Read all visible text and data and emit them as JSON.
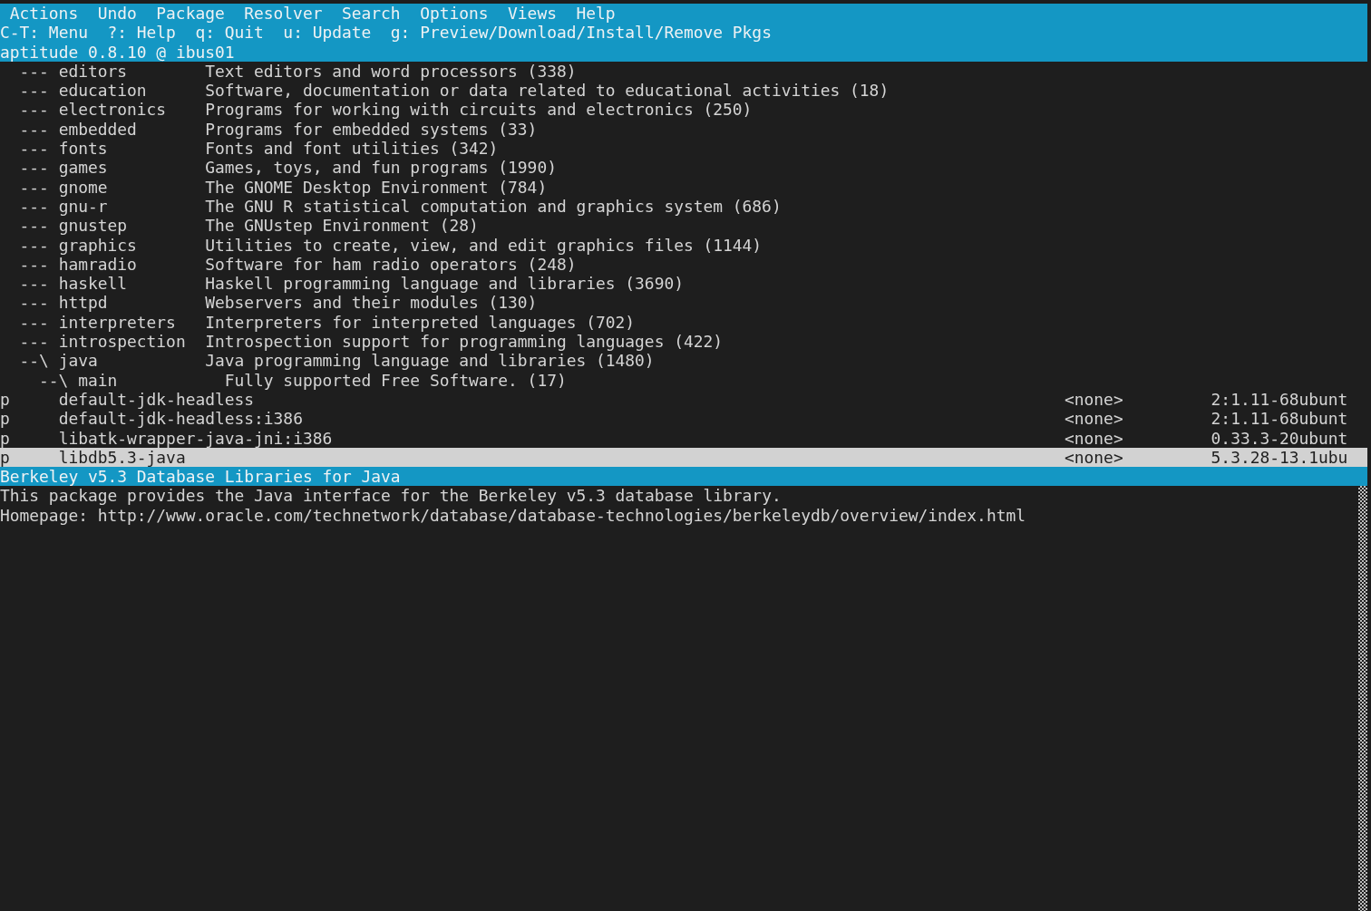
{
  "menu": [
    {
      "label": "Actions"
    },
    {
      "label": "Undo"
    },
    {
      "label": "Package"
    },
    {
      "label": "Resolver"
    },
    {
      "label": "Search"
    },
    {
      "label": "Options"
    },
    {
      "label": "Views"
    },
    {
      "label": "Help"
    }
  ],
  "shortcuts": "C-T: Menu  ?: Help  q: Quit  u: Update  g: Preview/Download/Install/Remove Pkgs",
  "title": "aptitude 0.8.10 @ ibus01",
  "tree": [
    {
      "marker": "---",
      "name": "editors",
      "description": "Text editors and word processors (338)"
    },
    {
      "marker": "---",
      "name": "education",
      "description": "Software, documentation or data related to educational activities (18)"
    },
    {
      "marker": "---",
      "name": "electronics",
      "description": "Programs for working with circuits and electronics (250)"
    },
    {
      "marker": "---",
      "name": "embedded",
      "description": "Programs for embedded systems (33)"
    },
    {
      "marker": "---",
      "name": "fonts",
      "description": "Fonts and font utilities (342)"
    },
    {
      "marker": "---",
      "name": "games",
      "description": "Games, toys, and fun programs (1990)"
    },
    {
      "marker": "---",
      "name": "gnome",
      "description": "The GNOME Desktop Environment (784)"
    },
    {
      "marker": "---",
      "name": "gnu-r",
      "description": "The GNU R statistical computation and graphics system (686)"
    },
    {
      "marker": "---",
      "name": "gnustep",
      "description": "The GNUstep Environment (28)"
    },
    {
      "marker": "---",
      "name": "graphics",
      "description": "Utilities to create, view, and edit graphics files (1144)"
    },
    {
      "marker": "---",
      "name": "hamradio",
      "description": "Software for ham radio operators (248)"
    },
    {
      "marker": "---",
      "name": "haskell",
      "description": "Haskell programming language and libraries (3690)"
    },
    {
      "marker": "---",
      "name": "httpd",
      "description": "Webservers and their modules (130)"
    },
    {
      "marker": "---",
      "name": "interpreters",
      "description": "Interpreters for interpreted languages (702)"
    },
    {
      "marker": "---",
      "name": "introspection",
      "description": "Introspection support for programming languages (422)"
    },
    {
      "marker": "--\\",
      "name": "java",
      "description": "Java programming language and libraries (1480)",
      "children": [
        {
          "marker": "--\\",
          "name": "main",
          "description": "Fully supported Free Software. (17)",
          "packages": [
            {
              "state": "p",
              "name": "default-jdk-headless",
              "current": "<none>",
              "candidate": "2:1.11-68ubunt",
              "selected": false
            },
            {
              "state": "p",
              "name": "default-jdk-headless:i386",
              "current": "<none>",
              "candidate": "2:1.11-68ubunt",
              "selected": false
            },
            {
              "state": "p",
              "name": "libatk-wrapper-java-jni:i386",
              "current": "<none>",
              "candidate": "0.33.3-20ubunt",
              "selected": false
            },
            {
              "state": "p",
              "name": "libdb5.3-java",
              "current": "<none>",
              "candidate": "5.3.28-13.1ubu",
              "selected": true
            }
          ]
        }
      ]
    }
  ],
  "info": {
    "title": "Berkeley v5.3 Database Libraries for Java",
    "lines": [
      "This package provides the Java interface for the Berkeley v5.3 database library.",
      "Homepage: http://www.oracle.com/technetwork/database/database-technologies/berkeleydb/overview/index.html"
    ]
  }
}
